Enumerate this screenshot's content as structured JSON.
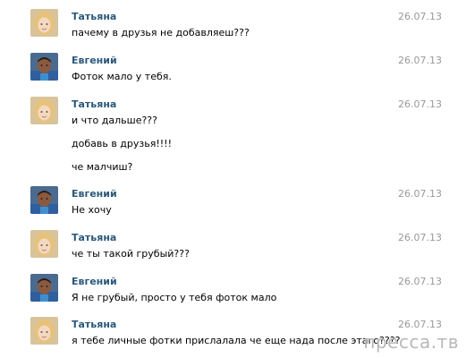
{
  "messages": [
    {
      "author": "Татьяна",
      "date": "26.07.13",
      "avatar": "avatar-tatiana",
      "lines": [
        "пачему в друзья не добавляеш???"
      ]
    },
    {
      "author": "Евгений",
      "date": "26.07.13",
      "avatar": "avatar-evgeny",
      "lines": [
        "Фоток мало у тебя."
      ]
    },
    {
      "author": "Татьяна",
      "date": "26.07.13",
      "avatar": "avatar-tatiana",
      "lines": [
        "и что дальше???",
        "добавь в друзья!!!!",
        "че малчиш?"
      ]
    },
    {
      "author": "Евгений",
      "date": "26.07.13",
      "avatar": "avatar-evgeny",
      "lines": [
        "Не хочу"
      ]
    },
    {
      "author": "Татьяна",
      "date": "26.07.13",
      "avatar": "avatar-tatiana",
      "lines": [
        "че ты такой грубый???"
      ]
    },
    {
      "author": "Евгений",
      "date": "26.07.13",
      "avatar": "avatar-evgeny",
      "lines": [
        "Я не грубый, просто у тебя фоток мало"
      ]
    },
    {
      "author": "Татьяна",
      "date": "26.07.13",
      "avatar": "avatar-tatiana",
      "lines": [
        "я тебе личные фотки прислалала че еще нада после этаго????"
      ]
    }
  ],
  "watermark": "пресса.тв"
}
